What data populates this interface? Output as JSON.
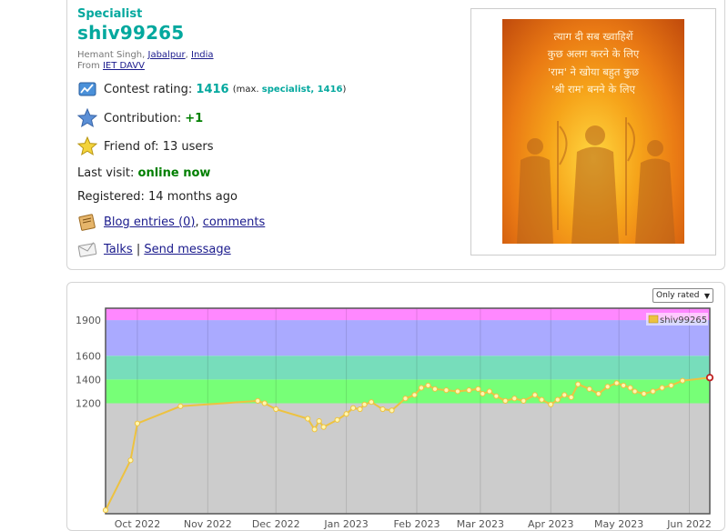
{
  "profile": {
    "rank": "Specialist",
    "handle": "shiv99265",
    "name": "Hemant Singh",
    "city": "Jabalpur",
    "country": "India",
    "from_label": "From",
    "organization": "IET DAVV",
    "contest_rating_label": "Contest rating:",
    "rating": "1416",
    "max_prefix": "(max.",
    "max_rank": "specialist, 1416",
    "max_suffix": ")",
    "contribution_label": "Contribution:",
    "contribution": "+1",
    "friend_label": "Friend of:",
    "friend_value": "13 users",
    "last_visit_label": "Last visit:",
    "last_visit": "online now",
    "registered_label": "Registered:",
    "registered": "14 months ago",
    "blog_link": "Blog entries (0)",
    "comments_link": "comments",
    "talks_link": "Talks",
    "separator": "|",
    "send_message_link": "Send message",
    "poster_lines": [
      "त्याग दी सब ख्वाहिशें",
      "कुछ अलग करने के लिए",
      "'राम' ने खोया बहुत कुछ",
      "'श्री राम' बनने के लिए"
    ]
  },
  "graph": {
    "dropdown_value": "Only rated",
    "legend": "shiv99265",
    "colors": {
      "line": "#edc240",
      "bands": [
        "#cccccc",
        "#77ff77",
        "#77ddbb",
        "#aaaaff",
        "#ff88ff"
      ]
    }
  },
  "chart_data": {
    "type": "line",
    "bands": [
      [
        0,
        1200
      ],
      [
        1200,
        1400
      ],
      [
        1400,
        1600
      ],
      [
        1600,
        1900
      ],
      [
        1900,
        2100
      ]
    ],
    "y_ticks": [
      1200,
      1400,
      1600,
      1900
    ],
    "ylim": [
      270,
      2000
    ],
    "x_ticks": [
      "Oct 2022",
      "Nov 2022",
      "Dec 2022",
      "Jan 2023",
      "Feb 2023",
      "Mar 2023",
      "Apr 2023",
      "May 2023",
      "Jun 2022"
    ],
    "xlim": [
      "2022-09-17",
      "2023-06-10"
    ],
    "series": [
      {
        "name": "shiv99265",
        "x": [
          "2022-09-17",
          "2022-09-28",
          "2022-10-01",
          "2022-10-20",
          "2022-11-23",
          "2022-11-26",
          "2022-12-01",
          "2022-12-15",
          "2022-12-18",
          "2022-12-20",
          "2022-12-22",
          "2022-12-28",
          "2023-01-01",
          "2023-01-04",
          "2023-01-07",
          "2023-01-09",
          "2023-01-12",
          "2023-01-17",
          "2023-01-21",
          "2023-01-27",
          "2023-01-31",
          "2023-02-03",
          "2023-02-06",
          "2023-02-09",
          "2023-02-14",
          "2023-02-19",
          "2023-02-24",
          "2023-02-28",
          "2023-03-02",
          "2023-03-05",
          "2023-03-08",
          "2023-03-12",
          "2023-03-16",
          "2023-03-20",
          "2023-03-25",
          "2023-03-28",
          "2023-04-01",
          "2023-04-04",
          "2023-04-07",
          "2023-04-10",
          "2023-04-13",
          "2023-04-18",
          "2023-04-22",
          "2023-04-26",
          "2023-04-30",
          "2023-05-03",
          "2023-05-06",
          "2023-05-08",
          "2023-05-12",
          "2023-05-16",
          "2023-05-20",
          "2023-05-24",
          "2023-05-29",
          "2023-06-10"
        ],
        "y": [
          300,
          720,
          1030,
          1175,
          1220,
          1200,
          1150,
          1070,
          980,
          1050,
          1000,
          1060,
          1110,
          1160,
          1150,
          1190,
          1210,
          1150,
          1140,
          1240,
          1270,
          1330,
          1350,
          1320,
          1310,
          1300,
          1310,
          1320,
          1280,
          1300,
          1260,
          1220,
          1240,
          1220,
          1270,
          1230,
          1190,
          1230,
          1270,
          1250,
          1360,
          1320,
          1280,
          1340,
          1370,
          1350,
          1330,
          1300,
          1280,
          1300,
          1330,
          1350,
          1390,
          1416
        ]
      }
    ]
  }
}
